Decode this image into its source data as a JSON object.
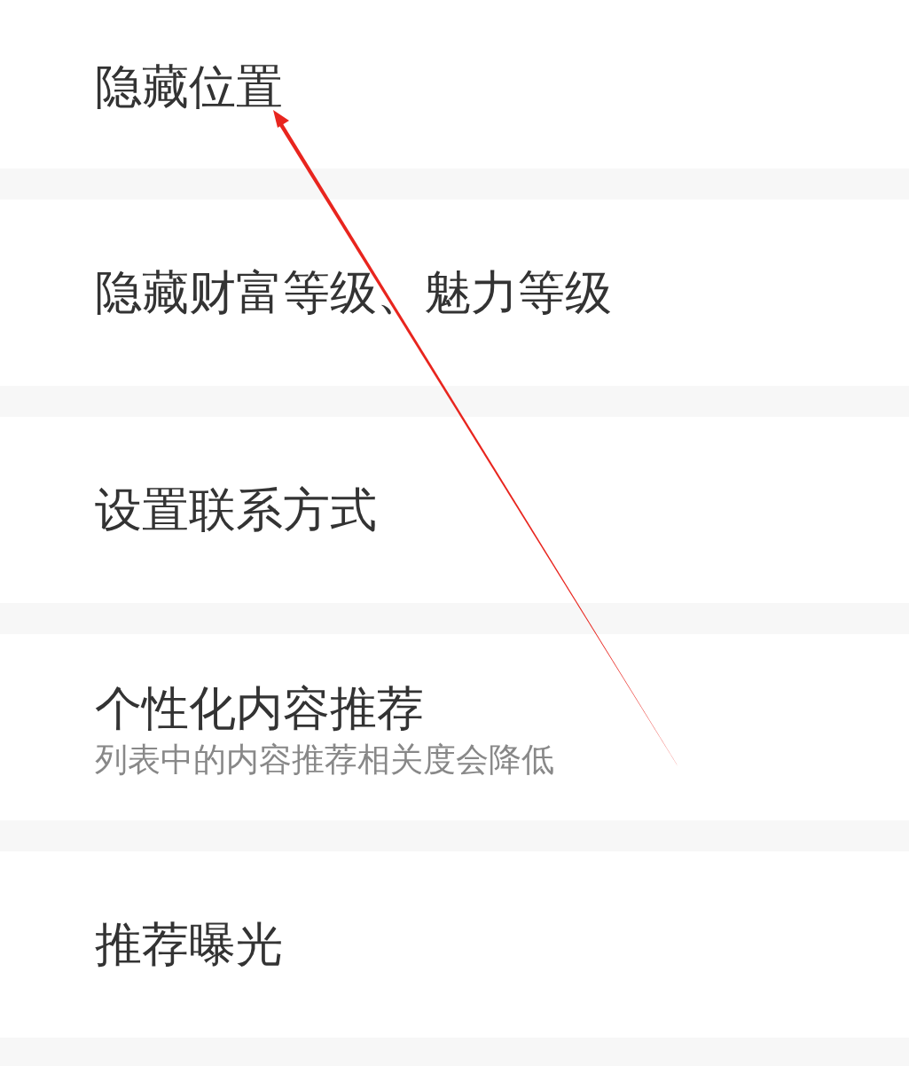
{
  "settings": [
    {
      "title": "隐藏位置"
    },
    {
      "title": "隐藏财富等级、魅力等级"
    },
    {
      "title": "设置联系方式"
    },
    {
      "title": "个性化内容推荐",
      "subtitle": "列表中的内容推荐相关度会降低"
    },
    {
      "title": "推荐曝光"
    }
  ]
}
